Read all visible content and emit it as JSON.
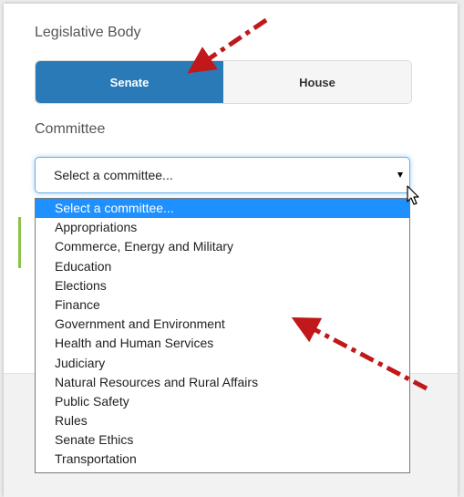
{
  "form": {
    "legislative_body_label": "Legislative Body",
    "committee_label": "Committee"
  },
  "toggle": {
    "senate_label": "Senate",
    "house_label": "House",
    "selected": "Senate"
  },
  "committee_select": {
    "current_value": "Select a committee...",
    "options": [
      "Select a committee...",
      "Appropriations",
      "Commerce, Energy and Military",
      "Education",
      "Elections",
      "Finance",
      "Government and Environment",
      "Health and Human Services",
      "Judiciary",
      "Natural Resources and Rural Affairs",
      "Public Safety",
      "Rules",
      "Senate Ethics",
      "Transportation"
    ]
  },
  "colors": {
    "accent": "#2a7ab8",
    "highlight": "#1e90ff",
    "annotation_arrow": "#c0181b"
  },
  "icons": [
    "caret-down-icon",
    "mouse-cursor-icon",
    "annotation-arrow-icon"
  ]
}
